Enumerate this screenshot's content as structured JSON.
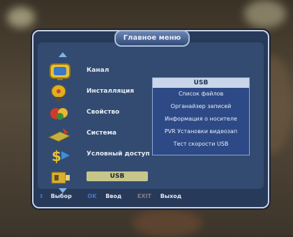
{
  "menu": {
    "title": "Главное меню",
    "items": [
      {
        "label": "Канал",
        "icon": "tv-icon"
      },
      {
        "label": "Инсталляция",
        "icon": "satellite-dish-icon"
      },
      {
        "label": "Свойство",
        "icon": "settings-icon"
      },
      {
        "label": "Система",
        "icon": "system-icon"
      },
      {
        "label": "Условный доступ",
        "icon": "dollar-icon"
      },
      {
        "label": "USB",
        "icon": "usb-camera-icon"
      }
    ],
    "selected_index": 5
  },
  "submenu": {
    "title": "USB",
    "items": [
      "Список файлов",
      "Органайзер записей",
      "Информация о носителе",
      "PVR Установки видеозап",
      "Тест скорости USB"
    ]
  },
  "footer": {
    "select_key": "⇕",
    "select_text": "Выбор",
    "ok_key": "OK",
    "ok_text": "Ввод",
    "exit_key": "EXIT",
    "exit_text": "Выход"
  },
  "colors": {
    "frame_border": "#c9d4e6",
    "panel": "#334b71",
    "highlight": "#c7c68a",
    "accent": "#7fb2e6"
  }
}
